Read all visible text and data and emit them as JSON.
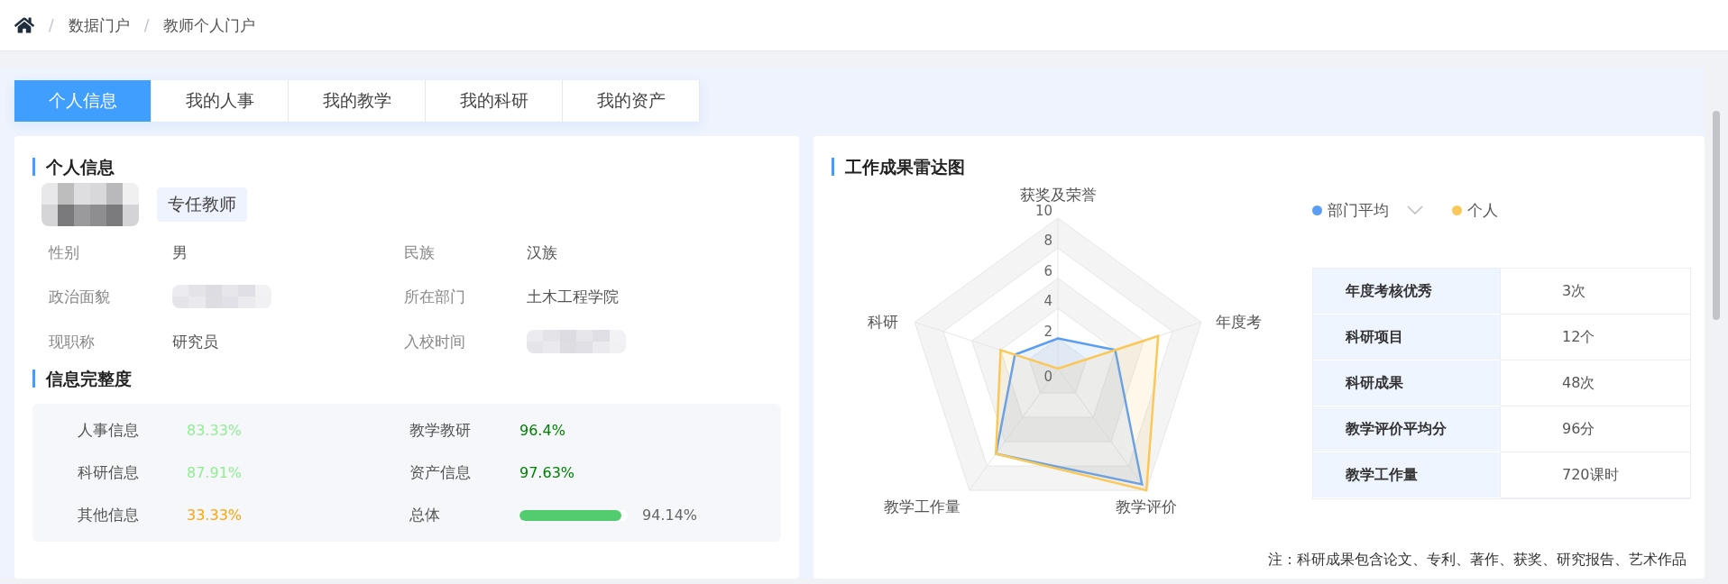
{
  "breadcrumb": [
    {
      "separator": "/",
      "label": "数据门户"
    },
    {
      "separator": "/",
      "label": "教师个人门户"
    }
  ],
  "tabs": [
    {
      "label": "个人信息",
      "selected": true
    },
    {
      "label": "我的人事",
      "selected": false
    },
    {
      "label": "我的教学",
      "selected": false
    },
    {
      "label": "我的科研",
      "selected": false
    },
    {
      "label": "我的资产",
      "selected": false
    }
  ],
  "personal": {
    "title": "个人信息",
    "tag": "专任教师",
    "fields": [
      {
        "label": "性别",
        "kind": "text",
        "value": "男"
      },
      {
        "label": "民族",
        "kind": "text",
        "value": "汉族"
      },
      {
        "label": "政治面貌",
        "kind": "redacted"
      },
      {
        "label": "所在部门",
        "kind": "text",
        "value": "土木工程学院"
      },
      {
        "label": "现职称",
        "kind": "text",
        "value": "研究员"
      },
      {
        "label": "入校时间",
        "kind": "redacted"
      }
    ]
  },
  "completeness": {
    "title": "信息完整度",
    "items": [
      {
        "label": "人事信息",
        "kind": "text",
        "value": "83.33%",
        "color": "#90ee90"
      },
      {
        "label": "教学教研",
        "kind": "text",
        "value": "96.4%",
        "color": "#008000"
      },
      {
        "label": "科研信息",
        "kind": "text",
        "value": "87.91%",
        "color": "#90ee90"
      },
      {
        "label": "资产信息",
        "kind": "text",
        "value": "97.63%",
        "color": "#008000"
      },
      {
        "label": "其他信息",
        "kind": "text",
        "value": "33.33%",
        "color": "#ffa500"
      },
      {
        "label": "总体",
        "kind": "bar",
        "level": 0.94,
        "reading": "94.14%"
      }
    ]
  },
  "radar": {
    "title": "工作成果雷达图",
    "axes": [
      "获奖及荣誉",
      "年度考",
      "教学评价",
      "教学工作量",
      "科研"
    ],
    "ticks": [
      "10",
      "8",
      "6",
      "4",
      "2",
      "0"
    ],
    "series": [
      {
        "name": "部门平均",
        "color": "#5b9df5"
      },
      {
        "name": "个人",
        "color": "#fac858"
      }
    ],
    "table": [
      {
        "label": "年度考核优秀",
        "value": "3次"
      },
      {
        "label": "科研项目",
        "value": "12个"
      },
      {
        "label": "科研成果",
        "value": "48次"
      },
      {
        "label": "教学评价平均分",
        "value": "96分"
      },
      {
        "label": "教学工作量",
        "value": "720课时"
      }
    ],
    "note": "注：科研成果包含论文、专利、著作、获奖、研究报告、艺术作品"
  }
}
